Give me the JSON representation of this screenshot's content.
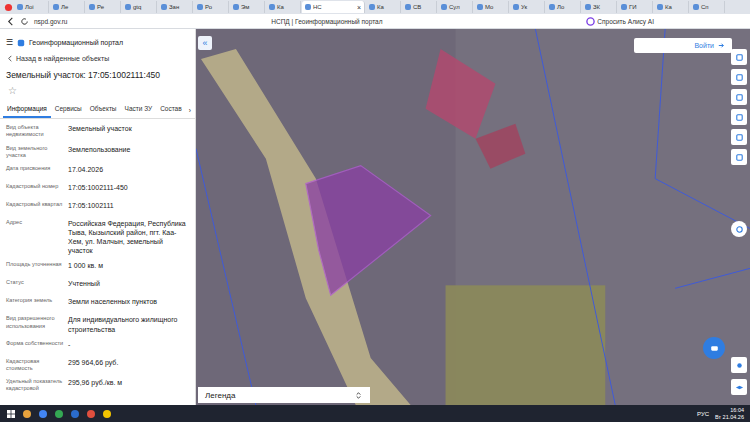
{
  "browser": {
    "tabs": [
      {
        "label": "Лоі",
        "selected": false
      },
      {
        "label": "Ле",
        "selected": false
      },
      {
        "label": "Ре",
        "selected": false
      },
      {
        "label": "gtq",
        "selected": false
      },
      {
        "label": "Зан",
        "selected": false
      },
      {
        "label": "Ро",
        "selected": false
      },
      {
        "label": "Эм",
        "selected": false
      },
      {
        "label": "Ка",
        "selected": false
      },
      {
        "label": "НС",
        "selected": true
      },
      {
        "label": "Ка",
        "selected": false
      },
      {
        "label": "СВ",
        "selected": false
      },
      {
        "label": "Сул",
        "selected": false
      },
      {
        "label": "Мо",
        "selected": false
      },
      {
        "label": "Ук",
        "selected": false
      },
      {
        "label": "Ло",
        "selected": false
      },
      {
        "label": "ЗК",
        "selected": false
      },
      {
        "label": "ГИ",
        "selected": false
      },
      {
        "label": "Ка",
        "selected": false
      },
      {
        "label": "Сп",
        "selected": false
      }
    ],
    "tab_close": "×",
    "address": "nspd.gov.ru",
    "page_title": "НСПД | Геоинформационный портал",
    "alice": "Спросить Алису AI"
  },
  "sidebar": {
    "menu": "☰",
    "portal_title": "Геоинформационный портал",
    "back": "Назад в найденные объекты",
    "title": "Земельный участок: 17:05:1002111:450",
    "star": "☆",
    "tabs": [
      {
        "label": "Информация",
        "selected": true
      },
      {
        "label": "Сервисы",
        "selected": false
      },
      {
        "label": "Объекты",
        "selected": false
      },
      {
        "label": "Части ЗУ",
        "selected": false
      },
      {
        "label": "Состав",
        "selected": false
      }
    ],
    "tabs_more": "›",
    "fields": [
      {
        "label": "Вид объекта недвижимости",
        "value": "Земельный участок"
      },
      {
        "label": "Вид земельного участка",
        "value": "Землепользование"
      },
      {
        "label": "Дата присвоения",
        "value": "17.04.2026"
      },
      {
        "label": "Кадастровый номер",
        "value": "17:05:1002111-450"
      },
      {
        "label": "Кадастровый квартал",
        "value": "17:05:1002111"
      },
      {
        "label": "Адрес",
        "value": "Российская Федерация, Республика Тыва, Кызылский район, пгт. Каа-Хем, ул. Малчын, земельный участок"
      },
      {
        "label": "Площадь уточненная",
        "value": "1 000 кв. м"
      },
      {
        "label": "Статус",
        "value": "Учтенный"
      },
      {
        "label": "Категория земель",
        "value": "Земли населенных пунктов"
      },
      {
        "label": "Вид разрешенного использования",
        "value": "Для индивидуального жилищного строительства"
      },
      {
        "label": "Форма собственности",
        "value": "-"
      },
      {
        "label": "Кадастровая стоимость",
        "value": "295 964,66 руб."
      },
      {
        "label": "Удельный показатель кадастровой",
        "value": "295,96 руб./кв. м"
      }
    ]
  },
  "map": {
    "collapse": "«",
    "login": "Войти",
    "legend": "Легенда"
  },
  "taskbar": {
    "lang": "РУС",
    "time": "16:04",
    "date": "Вт 21.04.26"
  }
}
